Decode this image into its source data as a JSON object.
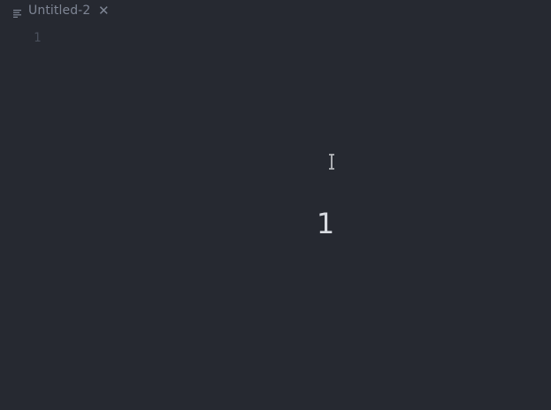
{
  "tab": {
    "title": "Untitled-2",
    "icon": "lines-icon",
    "close_icon": "close-icon",
    "close_glyph": "✕"
  },
  "editor": {
    "line_numbers": [
      "1"
    ],
    "content": ""
  },
  "overlay": {
    "value": "1"
  },
  "colors": {
    "background": "#262931",
    "muted_text": "#7e8594",
    "gutter_text": "#4a505c",
    "overlay_text": "#d8dbe1"
  }
}
